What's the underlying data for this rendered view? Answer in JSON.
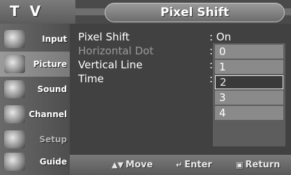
{
  "header": {
    "left_title": "T V",
    "menu_title": "Pixel Shift"
  },
  "sidebar": {
    "items": [
      {
        "label": "Input",
        "icon": "input-icon"
      },
      {
        "label": "Picture",
        "icon": "picture-icon"
      },
      {
        "label": "Sound",
        "icon": "sound-icon"
      },
      {
        "label": "Channel",
        "icon": "channel-icon"
      },
      {
        "label": "Setup",
        "icon": "setup-icon"
      },
      {
        "label": "Guide",
        "icon": "guide-icon"
      }
    ],
    "active_item": "Picture"
  },
  "menu": {
    "items": [
      {
        "label": "Pixel Shift",
        "value": ": On"
      },
      {
        "label": "Horizontal Dot",
        "value": ":"
      },
      {
        "label": "Vertical Line",
        "value": ":"
      },
      {
        "label": "Time",
        "value": ":"
      }
    ],
    "dropdown": {
      "options": [
        "0",
        "1",
        "2",
        "3",
        "4"
      ],
      "selected": "2"
    }
  },
  "footer": {
    "move": "Move",
    "enter": "Enter",
    "return": "Return"
  },
  "colors": {
    "background": "#414141",
    "selected_border": "#ffffff",
    "text": "#ffffff"
  }
}
